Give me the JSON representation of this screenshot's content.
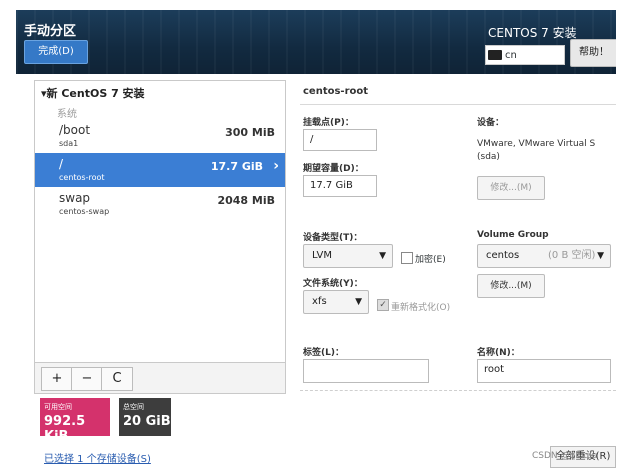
{
  "header": {
    "title": "手动分区",
    "done_label": "完成(D)",
    "install_title": "CENTOS 7 安装",
    "keyboard": "cn",
    "help_label": "帮助！"
  },
  "tree": {
    "root_label": "▾新 CentOS 7 安装",
    "system_label": "系统",
    "mounts": [
      {
        "name": "/boot",
        "device": "sda1",
        "size": "300 MiB"
      },
      {
        "name": "/",
        "device": "centos-root",
        "size": "17.7 GiB"
      },
      {
        "name": "swap",
        "device": "centos-swap",
        "size": "2048 MiB"
      }
    ]
  },
  "toolbar": {
    "add": "+",
    "remove": "−",
    "refresh": "C"
  },
  "space": {
    "available_label": "可用空间",
    "available_value": "992.5 KiB",
    "total_label": "总空间",
    "total_value": "20 GiB"
  },
  "storage_link": "已选择 1 个存储设备(S)",
  "details": {
    "title": "centos-root",
    "mount_point_label": "挂载点(P)：",
    "mount_point_value": "/",
    "capacity_label": "期望容量(D)：",
    "capacity_value": "17.7 GiB",
    "device_label": "设备：",
    "device_value": "VMware, VMware Virtual S (sda)",
    "modify_label": "修改...(M)",
    "device_type_label": "设备类型(T)：",
    "device_type_value": "LVM",
    "encrypt_label": "加密(E)",
    "filesystem_label": "文件系统(Y)：",
    "filesystem_value": "xfs",
    "reformat_label": "重新格式化(O)",
    "volume_group_label": "Volume Group",
    "volume_group_value": "centos",
    "volume_group_free": "(0 B 空闲)",
    "vg_modify_label": "修改...(M)",
    "tag_label": "标签(L)：",
    "tag_value": "",
    "name_label": "名称(N)：",
    "name_value": "root"
  },
  "reset_label": "全部重设(R)",
  "watermark": "CSDN @qiuqiu"
}
